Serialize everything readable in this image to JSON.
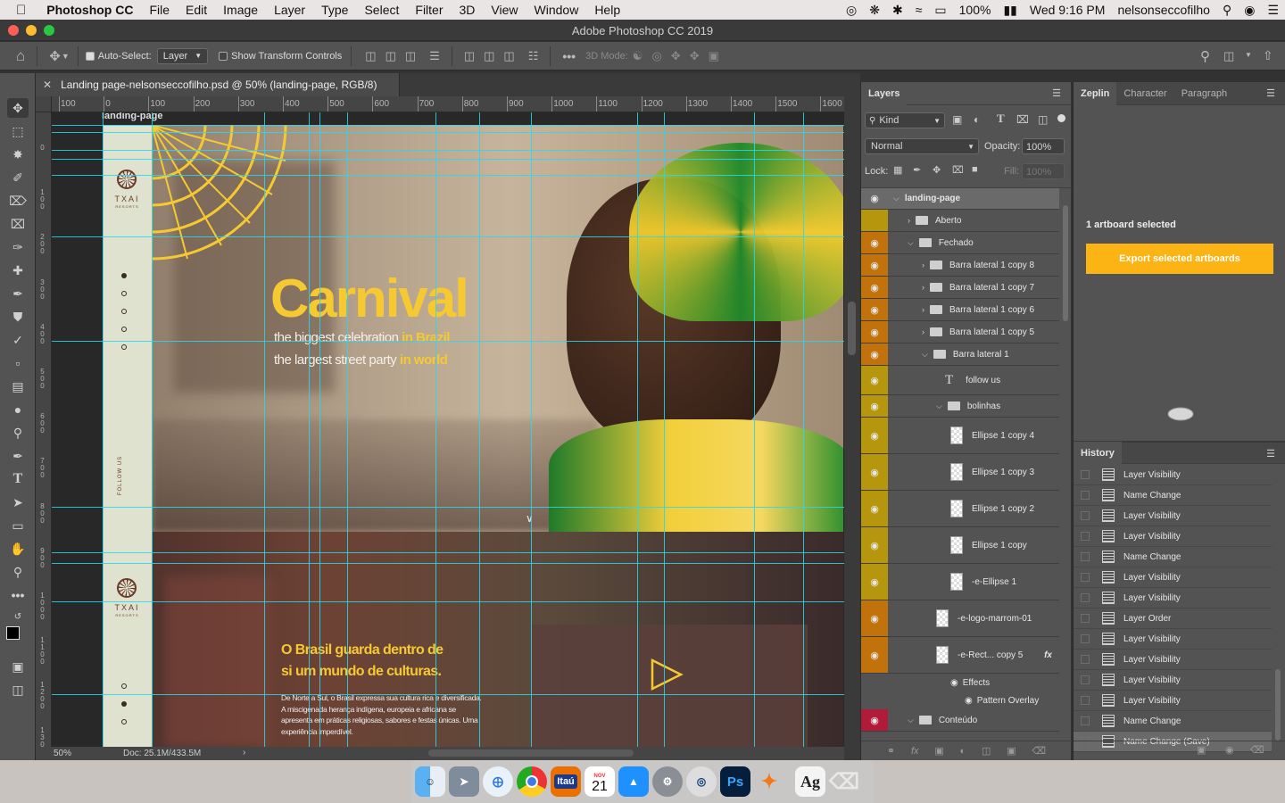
{
  "menubar": {
    "apple": "",
    "app": "Photoshop CC",
    "items": [
      "File",
      "Edit",
      "Image",
      "Layer",
      "Type",
      "Select",
      "Filter",
      "3D",
      "View",
      "Window",
      "Help"
    ],
    "battery": "100%",
    "clock": "Wed 9:16 PM",
    "user": "nelsonseccofilho"
  },
  "window": {
    "title": "Adobe Photoshop CC 2019"
  },
  "options": {
    "auto_select": "Auto-Select:",
    "auto_select_value": "Layer",
    "show_transform": "Show Transform Controls",
    "mode_3d": "3D Mode:"
  },
  "document": {
    "tab_title": "Landing page-nelsonseccofilho.psd @ 50% (landing-page, RGB/8)",
    "artboard_label": "landing-page",
    "zoom": "50%",
    "doc_size": "Doc: 25.1M/433.5M"
  },
  "ruler_top": [
    "100",
    "0",
    "100",
    "200",
    "300",
    "400",
    "500",
    "600",
    "700",
    "800",
    "900",
    "1000",
    "1100",
    "1200",
    "1300",
    "1400",
    "1500",
    "1600"
  ],
  "ruler_left": [
    "0",
    "100",
    "200",
    "300",
    "400",
    "500",
    "600",
    "700",
    "800",
    "900",
    "1000",
    "1100",
    "1200",
    "1300"
  ],
  "design": {
    "brand": "TXAI",
    "brand_sub": "RESORTS",
    "follow": "FOLLOW US",
    "hero_title": "Carnival",
    "hero_line1": "the biggest celebration",
    "hero_line1_accent": "in Brazil",
    "hero_line2": "the largest street party",
    "hero_line2_accent": "in world",
    "sec2_title1": "O Brasil guarda dentro de",
    "sec2_title2": "si um mundo de culturas.",
    "sec2_body": "De Norte a Sul, o Brasil expressa sua cultura rica e diversificada. A miscigenada herança indígena, europeia e africana se apresenta em práticas religiosas, sabores e festas únicas. Uma experiência imperdível.",
    "accent": "#f6c933"
  },
  "layers_panel": {
    "tab": "Layers",
    "filter": "Kind",
    "blend": "Normal",
    "opacity_label": "Opacity:",
    "opacity": "100%",
    "lock_label": "Lock:",
    "fill_label": "Fill:",
    "fill": "100%",
    "layers": [
      {
        "name": "landing-page",
        "indent": 0,
        "kind": "artboard",
        "eye": true,
        "color": "none"
      },
      {
        "name": "Aberto",
        "indent": 1,
        "kind": "folder",
        "eye": false,
        "color": "#b5960c"
      },
      {
        "name": "Fechado",
        "indent": 1,
        "kind": "folder",
        "eye": true,
        "color": "#c1720a"
      },
      {
        "name": "Barra lateral 1 copy 8",
        "indent": 2,
        "kind": "folder",
        "eye": true,
        "color": "#c1720a"
      },
      {
        "name": "Barra lateral 1 copy 7",
        "indent": 2,
        "kind": "folder",
        "eye": true,
        "color": "#c1720a"
      },
      {
        "name": "Barra lateral 1 copy 6",
        "indent": 2,
        "kind": "folder",
        "eye": true,
        "color": "#c1720a"
      },
      {
        "name": "Barra lateral 1 copy 5",
        "indent": 2,
        "kind": "folder",
        "eye": true,
        "color": "#c1720a"
      },
      {
        "name": "Barra lateral 1",
        "indent": 2,
        "kind": "folder",
        "eye": true,
        "color": "#c1720a"
      },
      {
        "name": "follow us",
        "indent": 3,
        "kind": "text",
        "eye": true,
        "color": "#b5960c"
      },
      {
        "name": "bolinhas",
        "indent": 3,
        "kind": "folder",
        "eye": true,
        "color": "#b5960c"
      },
      {
        "name": "Ellipse 1 copy 4",
        "indent": 4,
        "kind": "shape",
        "eye": true,
        "color": "#b5960c"
      },
      {
        "name": "Ellipse 1 copy 3",
        "indent": 4,
        "kind": "shape",
        "eye": true,
        "color": "#b5960c"
      },
      {
        "name": "Ellipse 1 copy 2",
        "indent": 4,
        "kind": "shape",
        "eye": true,
        "color": "#b5960c"
      },
      {
        "name": "Ellipse 1 copy",
        "indent": 4,
        "kind": "shape",
        "eye": true,
        "color": "#b5960c"
      },
      {
        "name": "-e-Ellipse 1",
        "indent": 4,
        "kind": "shape",
        "eye": true,
        "color": "#b5960c"
      },
      {
        "name": "-e-logo-marrom-01",
        "indent": 3,
        "kind": "shape",
        "eye": true,
        "color": "#c1720a"
      },
      {
        "name": "-e-Rect... copy 5",
        "indent": 3,
        "kind": "shape",
        "eye": true,
        "color": "#c1720a",
        "fx": "fx"
      },
      {
        "name": "Effects",
        "indent": 4,
        "kind": "effect",
        "eye": true,
        "color": "none"
      },
      {
        "name": "Pattern Overlay",
        "indent": 5,
        "kind": "effect",
        "eye": true,
        "color": "none"
      },
      {
        "name": "Conteúdo",
        "indent": 1,
        "kind": "folder",
        "eye": true,
        "color": "#b21a3a"
      }
    ]
  },
  "zeplin": {
    "tabs": [
      "Zeplin",
      "Character",
      "Paragraph"
    ],
    "selected": "1 artboard selected",
    "export": "Export selected artboards"
  },
  "history": {
    "title": "History",
    "items": [
      "Layer Visibility",
      "Name Change",
      "Layer Visibility",
      "Layer Visibility",
      "Name Change",
      "Layer Visibility",
      "Layer Visibility",
      "Layer Order",
      "Layer Visibility",
      "Layer Visibility",
      "Layer Visibility",
      "Layer Visibility",
      "Name Change",
      "Name Change (Save)"
    ]
  },
  "dock": {
    "items": [
      "finder",
      "launchpad",
      "safari",
      "chrome",
      "itau",
      "calendar",
      "app-store",
      "system-preferences",
      "sketch",
      "photoshop",
      "xmind",
      "font-book",
      "trash"
    ],
    "itau": "Itaú",
    "calendar_month": "NOV",
    "calendar_day": "21",
    "ps": "Ps",
    "fontbook": "Ag"
  }
}
